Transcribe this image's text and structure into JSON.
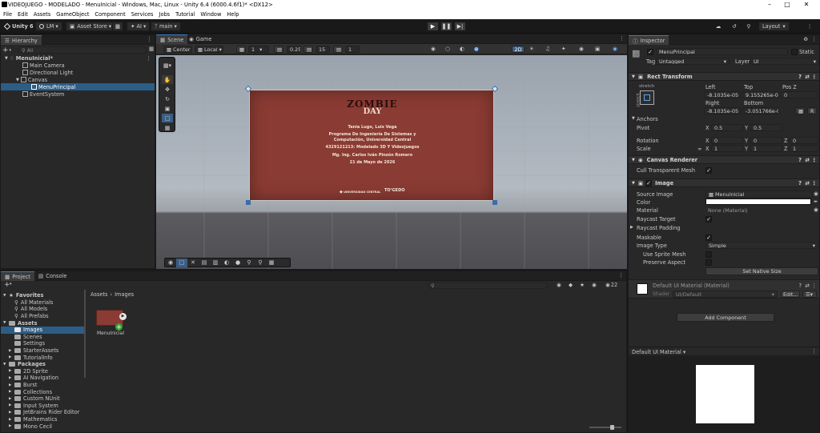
{
  "titlebar": {
    "title": "VIDEOJUEGO - MODELADO - MenuInicial - Windows, Mac, Linux - Unity 6.4 (6000.4.6f1)* <DX12>"
  },
  "menubar": [
    "File",
    "Edit",
    "Assets",
    "GameObject",
    "Component",
    "Services",
    "Jobs",
    "Tutorial",
    "Window",
    "Help"
  ],
  "toolbar": {
    "unity": "Unity 6",
    "account": "LM",
    "asset_store": "Asset Store",
    "ai": "AI",
    "branch": "main",
    "layout": "Layout"
  },
  "hierarchy": {
    "tab": "Hierarchy",
    "search_placeholder": "All",
    "items": [
      {
        "label": "MenuInicial*"
      },
      {
        "label": "Main Camera"
      },
      {
        "label": "Directional Light"
      },
      {
        "label": "Canvas"
      },
      {
        "label": "MenuPrincipal"
      },
      {
        "label": "EventSystem"
      }
    ]
  },
  "scene": {
    "tabs": [
      "Scene",
      "Game"
    ],
    "pivot": "Center",
    "space": "Local",
    "grid_count": "1",
    "snap_value": "0.25",
    "angle": "15",
    "scale": "1",
    "mode_2d": "2D",
    "canvas": {
      "logo_title": "ZOMBIE",
      "logo_sub": "DAY",
      "authors": "Tania Lugo, Luis Vega",
      "program": "Programa De Ingeniería De Sistemas y Computación, Universidad Central",
      "course": "4329121213: Modelado 3D Y Videojuegos",
      "teacher": "Mg. Ing. Carlos Iván Pinzón Romero",
      "date": "21 de Mayo de 2026",
      "logo_left": "UNIVERSIDAD CENTRAL",
      "logo_right": "TO’GEDO"
    }
  },
  "project": {
    "tabs": [
      "Project",
      "Console"
    ],
    "breadcrumb": [
      "Assets",
      "Images"
    ],
    "count": "22",
    "tree": [
      {
        "label": "Favorites",
        "level": 0,
        "bold": true
      },
      {
        "label": "All Materials",
        "level": 1
      },
      {
        "label": "All Models",
        "level": 1
      },
      {
        "label": "All Prefabs",
        "level": 1
      },
      {
        "label": "Assets",
        "level": 0,
        "bold": true
      },
      {
        "label": "Images",
        "level": 1,
        "selected": true
      },
      {
        "label": "Scenes",
        "level": 1
      },
      {
        "label": "Settings",
        "level": 1
      },
      {
        "label": "StarterAssets",
        "level": 1
      },
      {
        "label": "TutorialInfo",
        "level": 1
      },
      {
        "label": "Packages",
        "level": 0,
        "bold": true
      },
      {
        "label": "2D Sprite",
        "level": 1
      },
      {
        "label": "AI Navigation",
        "level": 1
      },
      {
        "label": "Burst",
        "level": 1
      },
      {
        "label": "Collections",
        "level": 1
      },
      {
        "label": "Custom NUnit",
        "level": 1
      },
      {
        "label": "Input System",
        "level": 1
      },
      {
        "label": "JetBrains Rider Editor",
        "level": 1
      },
      {
        "label": "Mathematics",
        "level": 1
      },
      {
        "label": "Mono Cecil",
        "level": 1
      }
    ],
    "asset": {
      "label": "MenuInicial"
    }
  },
  "inspector": {
    "tab": "Inspector",
    "object_name": "MenuPrincipal",
    "static": "Static",
    "tag_label": "Tag",
    "tag_value": "Untagged",
    "layer_label": "Layer",
    "layer_value": "UI",
    "rect": {
      "title": "Rect Transform",
      "stretch": "stretch",
      "left_label": "Left",
      "left": "-8.1035e-05",
      "top_label": "Top",
      "top": "9.155265e-05",
      "posz_label": "Pos Z",
      "posz": "0",
      "right_label": "Right",
      "right": "-8.1035e-05",
      "bottom_label": "Bottom",
      "bottom": "-3.051766e-05",
      "anchors": "Anchors",
      "pivot_label": "Pivot",
      "pivot_x": "0.5",
      "pivot_y": "0.5",
      "rotation_label": "Rotation",
      "rot_x": "0",
      "rot_y": "0",
      "rot_z": "0",
      "scale_label": "Scale",
      "scale_x": "1",
      "scale_y": "1",
      "scale_z": "1",
      "x": "X",
      "y": "Y",
      "z": "Z",
      "r": "R"
    },
    "canvas_renderer": {
      "title": "Canvas Renderer",
      "cull_label": "Cull Transparent Mesh"
    },
    "image": {
      "title": "Image",
      "source_label": "Source Image",
      "source_value": "MenuInicial",
      "color_label": "Color",
      "material_label": "Material",
      "material_value": "None (Material)",
      "raycast_label": "Raycast Target",
      "padding_label": "Raycast Padding",
      "maskable_label": "Maskable",
      "type_label": "Image Type",
      "type_value": "Simple",
      "sprite_mesh_label": "Use Sprite Mesh",
      "preserve_label": "Preserve Aspect",
      "native_button": "Set Native Size"
    },
    "material": {
      "title": "Default UI Material (Material)",
      "shader_label": "Shader",
      "shader_value": "UI/Default",
      "edit": "Edit..."
    },
    "add_component": "Add Component",
    "preview_label": "Default UI Material"
  },
  "colors": {
    "accent": "#2c5d87",
    "canvas_bg": "#8a3b33",
    "sky": "#a9b1bb",
    "ground": "#56565a"
  }
}
